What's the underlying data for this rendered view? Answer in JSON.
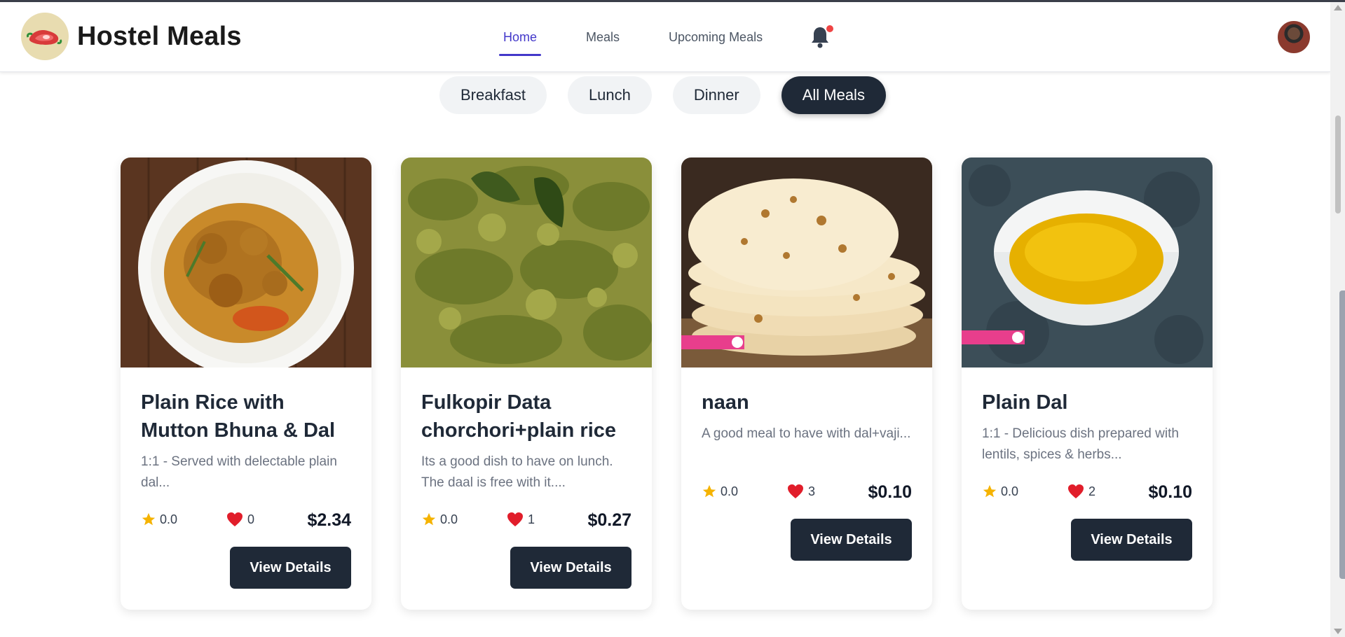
{
  "app": {
    "brand": "Hostel Meals"
  },
  "nav": {
    "items": [
      {
        "label": "Home",
        "active": true
      },
      {
        "label": "Meals",
        "active": false
      },
      {
        "label": "Upcoming Meals",
        "active": false
      }
    ],
    "notification_icon": "bell-icon",
    "has_notification": true
  },
  "filters": [
    {
      "label": "Breakfast",
      "active": false
    },
    {
      "label": "Lunch",
      "active": false
    },
    {
      "label": "Dinner",
      "active": false
    },
    {
      "label": "All Meals",
      "active": true
    }
  ],
  "meals": [
    {
      "title": "Plain Rice with Mutton Bhuna & Dal",
      "description": "1:1 - Served with delectable plain dal...",
      "rating": "0.0",
      "likes": "0",
      "price": "$2.34",
      "button": "View Details"
    },
    {
      "title": "Fulkopir Data chorchori+plain rice",
      "description": "Its a good dish to have on lunch. The daal is free with it....",
      "rating": "0.0",
      "likes": "1",
      "price": "$0.27",
      "button": "View Details"
    },
    {
      "title": "naan",
      "description": "A good meal to have with dal+vaji...",
      "rating": "0.0",
      "likes": "3",
      "price": "$0.10",
      "button": "View Details"
    },
    {
      "title": "Plain Dal",
      "description": "1:1 - Delicious dish prepared with lentils, spices & herbs...",
      "rating": "0.0",
      "likes": "2",
      "price": "$0.10",
      "button": "View Details"
    }
  ],
  "colors": {
    "accent": "#4338ca",
    "dark": "#1f2937",
    "star": "#f5b301",
    "heart": "#e11d2a",
    "notification_dot": "#ef4444"
  }
}
